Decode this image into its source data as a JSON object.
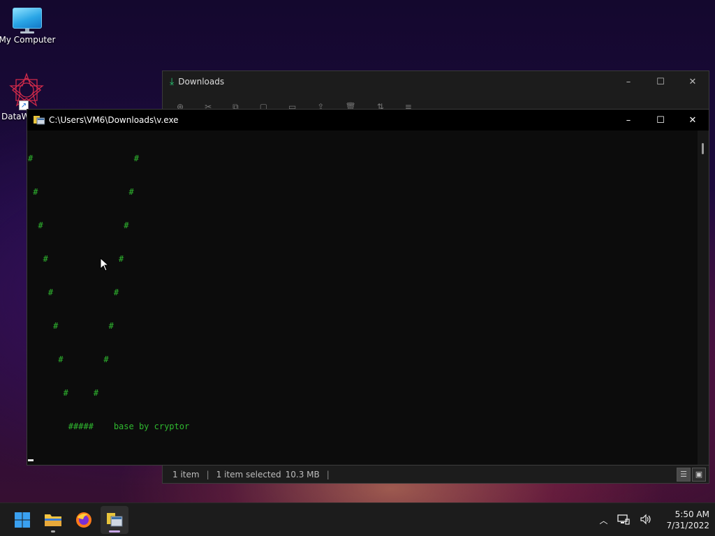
{
  "desktop": {
    "icons": [
      {
        "label": "My Computer"
      },
      {
        "label": "DataW"
      }
    ]
  },
  "explorer": {
    "title": "Downloads",
    "status": {
      "items": "1 item",
      "selected": "1 item selected",
      "size": "10.3 MB"
    },
    "controls": {
      "minimize": "–",
      "maximize": "☐",
      "close": "✕"
    }
  },
  "console": {
    "title": "C:\\Users\\VM6\\Downloads\\v.exe",
    "lines": [
      "#                    #",
      " #                  #",
      "  #                #",
      "   #              #",
      "    #            #",
      "     #          #",
      "      #        #",
      "       #     #",
      "        #####    base by cryptor"
    ],
    "controls": {
      "minimize": "–",
      "maximize": "☐",
      "close": "✕"
    }
  },
  "taskbar": {
    "apps": [
      {
        "name": "Start",
        "icon": "windows-start-icon"
      },
      {
        "name": "File Explorer",
        "icon": "folder-icon"
      },
      {
        "name": "Firefox",
        "icon": "firefox-icon"
      },
      {
        "name": "v.exe",
        "icon": "console-app-icon"
      }
    ],
    "tray": {
      "time": "5:50 AM",
      "date": "7/31/2022",
      "chevron": "^"
    }
  }
}
